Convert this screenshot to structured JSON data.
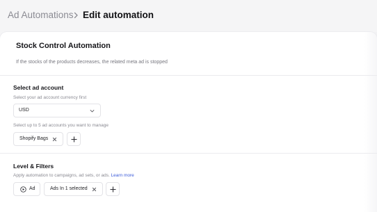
{
  "breadcrumb": {
    "parent": "Ad Automations",
    "current": "Edit automation"
  },
  "automation": {
    "title": "Stock Control Automation",
    "description": "If the stocks of the products decreases, the related meta ad is stopped"
  },
  "ad_account": {
    "title": "Select ad account",
    "currency_hint": "Select your ad account currency first",
    "currency_value": "USD",
    "accounts_hint": "Select up to 5 ad accounts you want to manage",
    "accounts": [
      "Shopify Bags"
    ]
  },
  "level_filters": {
    "title": "Level & Filters",
    "hint": "Apply automation to campaigns, ad sets, or ads.",
    "learn_more": "Learn more",
    "level_label": "Ad",
    "filter_label": "Ads In 1 selected"
  },
  "icons": {
    "breadcrumb_separator": "chevron-right-icon",
    "select_caret": "chevron-down-icon",
    "remove": "close-icon",
    "add": "plus-icon",
    "level": "play-circle-icon"
  },
  "colors": {
    "background": "#f5f5f6",
    "card": "#ffffff",
    "link": "#3b5bd9",
    "muted_text": "#8a8a92"
  }
}
